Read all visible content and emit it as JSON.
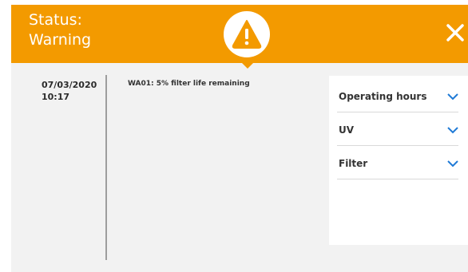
{
  "header": {
    "status_line1": "Status:",
    "status_line2": "Warning",
    "color": "#f39a00",
    "badge_icon": "warning-triangle-icon",
    "close_icon": "close-icon"
  },
  "timeline": {
    "entries": [
      {
        "date": "07/03/2020",
        "time": "10:17",
        "message": "WA01: 5% filter life remaining"
      }
    ]
  },
  "details_panel": {
    "items": [
      {
        "label": "Operating hours",
        "icon": "chevron-down-icon"
      },
      {
        "label": "UV",
        "icon": "chevron-down-icon"
      },
      {
        "label": "Filter",
        "icon": "chevron-down-icon"
      }
    ],
    "accent_color": "#1f7ad6"
  }
}
